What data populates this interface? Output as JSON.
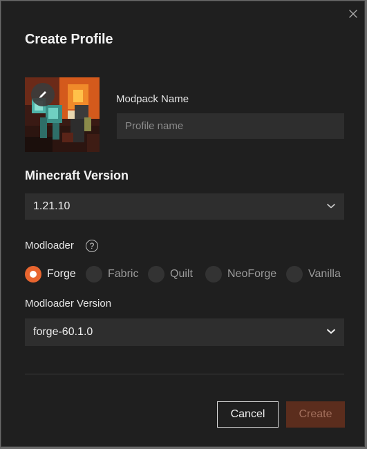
{
  "dialog": {
    "title": "Create Profile"
  },
  "profile": {
    "name_label": "Modpack Name",
    "name_placeholder": "Profile name",
    "name_value": ""
  },
  "minecraft": {
    "label": "Minecraft Version",
    "selected": "1.21.10"
  },
  "modloader": {
    "label": "Modloader",
    "help_glyph": "?",
    "options": [
      {
        "label": "Forge",
        "selected": true
      },
      {
        "label": "Fabric",
        "selected": false
      },
      {
        "label": "Quilt",
        "selected": false
      },
      {
        "label": "NeoForge",
        "selected": false
      },
      {
        "label": "Vanilla",
        "selected": false
      }
    ],
    "version_label": "Modloader Version",
    "version_selected": "forge-60.1.0"
  },
  "actions": {
    "cancel": "Cancel",
    "create": "Create",
    "create_enabled": false
  },
  "colors": {
    "accent": "#e8652f",
    "background": "#1f1f1f",
    "field": "#2e2e2e",
    "create_disabled_bg": "#5b2d1d"
  },
  "icons": [
    "close-icon",
    "pencil-icon",
    "chevron-down-icon",
    "help-icon"
  ]
}
